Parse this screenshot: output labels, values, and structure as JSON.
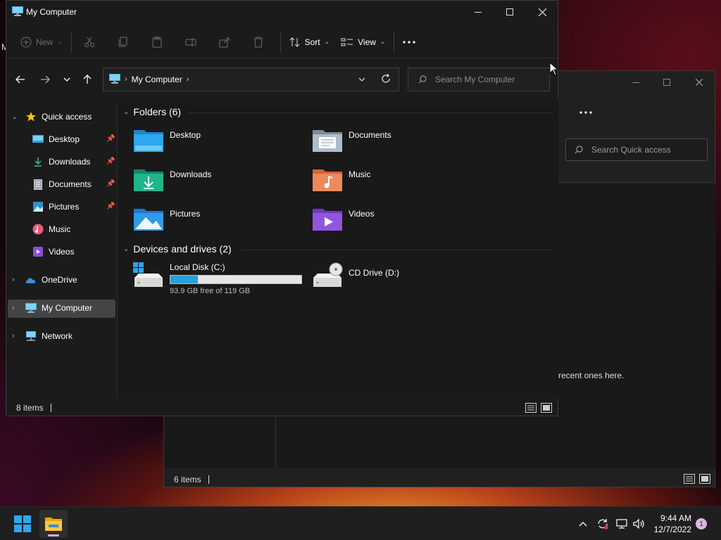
{
  "desktop": {
    "stray_letter": "M"
  },
  "back_window": {
    "search_placeholder": "Search Quick access",
    "empty_text": "recent ones here.",
    "status": "6 items"
  },
  "window": {
    "title": "My Computer",
    "toolbar": {
      "new_label": "New",
      "sort_label": "Sort",
      "view_label": "View",
      "more_label": "..."
    },
    "address": {
      "crumb": "My Computer"
    },
    "search_placeholder": "Search My Computer",
    "sidebar": {
      "quick_access": "Quick access",
      "items": [
        {
          "label": "Desktop",
          "pinned": true
        },
        {
          "label": "Downloads",
          "pinned": true
        },
        {
          "label": "Documents",
          "pinned": true
        },
        {
          "label": "Pictures",
          "pinned": true
        },
        {
          "label": "Music",
          "pinned": false
        },
        {
          "label": "Videos",
          "pinned": false
        }
      ],
      "onedrive": "OneDrive",
      "my_computer": "My Computer",
      "network": "Network"
    },
    "folders_header": "Folders (6)",
    "folders": [
      {
        "label": "Desktop",
        "icon": "desktop-folder-icon"
      },
      {
        "label": "Documents",
        "icon": "documents-folder-icon"
      },
      {
        "label": "Downloads",
        "icon": "downloads-folder-icon"
      },
      {
        "label": "Music",
        "icon": "music-folder-icon"
      },
      {
        "label": "Pictures",
        "icon": "pictures-folder-icon"
      },
      {
        "label": "Videos",
        "icon": "videos-folder-icon"
      }
    ],
    "drives_header": "Devices and drives (2)",
    "drives": [
      {
        "label": "Local Disk (C:)",
        "free_text": "93.9 GB free of 119 GB",
        "used_fraction": 0.21
      },
      {
        "label": "CD Drive (D:)"
      }
    ],
    "status": "8 items"
  },
  "taskbar": {
    "time": "9:44 AM",
    "date": "12/7/2022",
    "notification_count": "1"
  },
  "colors": {
    "accent": "#26a0da",
    "selection": "#444444",
    "window_bg": "#1b1b1b"
  }
}
